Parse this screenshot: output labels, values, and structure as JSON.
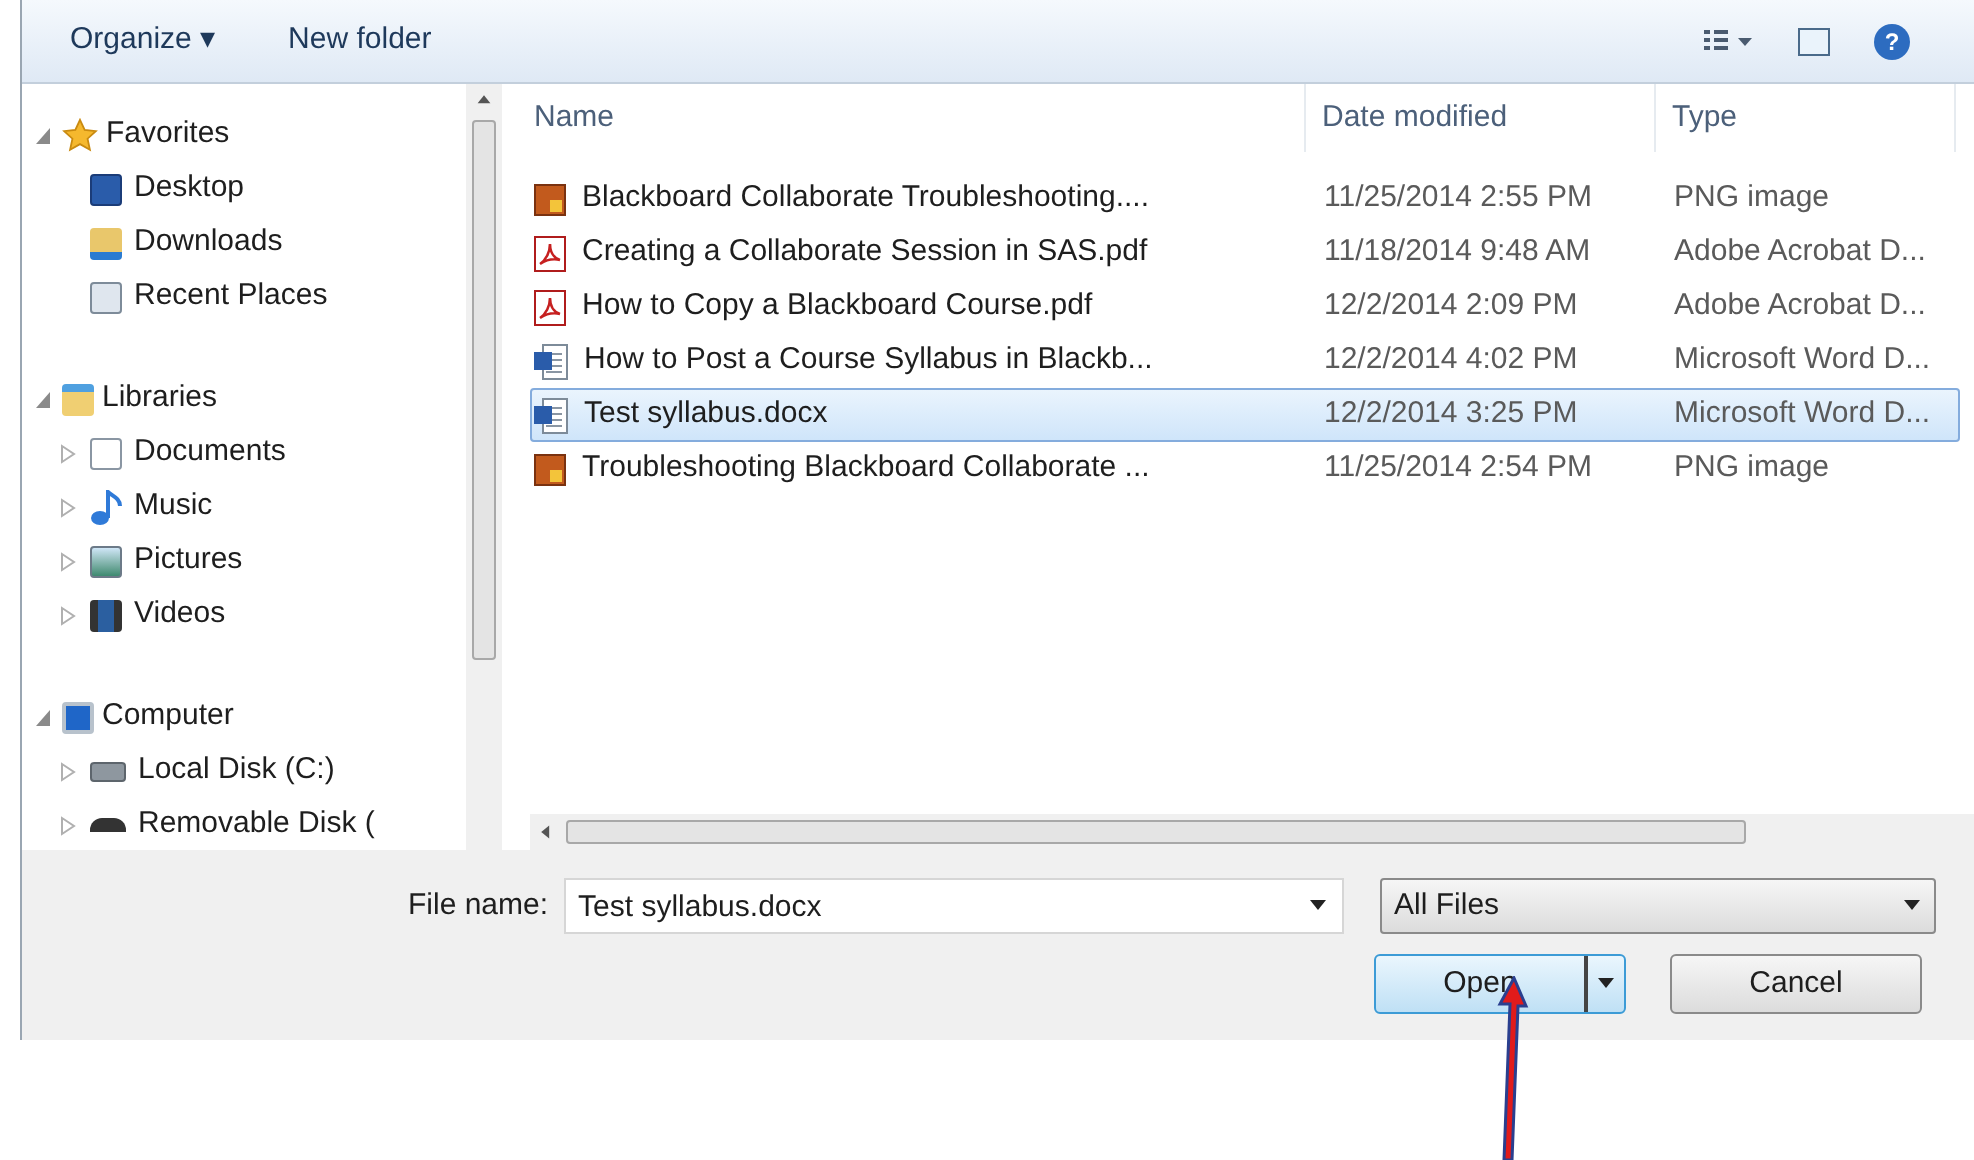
{
  "toolbar": {
    "organize": "Organize ▾",
    "new_folder": "New folder",
    "help": "?"
  },
  "sidebar": [
    {
      "label": "Favorites",
      "kind": "star",
      "expanded": true,
      "children": [
        {
          "label": "Desktop",
          "kind": "desktop",
          "has_children": false
        },
        {
          "label": "Downloads",
          "kind": "downloads",
          "has_children": false
        },
        {
          "label": "Recent Places",
          "kind": "recent",
          "has_children": false
        }
      ]
    },
    {
      "label": "Libraries",
      "kind": "library",
      "expanded": true,
      "children": [
        {
          "label": "Documents",
          "kind": "documents",
          "has_children": true
        },
        {
          "label": "Music",
          "kind": "music",
          "has_children": true
        },
        {
          "label": "Pictures",
          "kind": "pictures",
          "has_children": true
        },
        {
          "label": "Videos",
          "kind": "videos",
          "has_children": true
        }
      ]
    },
    {
      "label": "Computer",
      "kind": "computer",
      "expanded": true,
      "children": [
        {
          "label": "Local Disk (C:)",
          "kind": "disk",
          "has_children": true
        },
        {
          "label": "Removable Disk (",
          "kind": "removable",
          "has_children": true
        }
      ]
    }
  ],
  "table": {
    "columns": [
      "Name",
      "Date modified",
      "Type"
    ],
    "rows": [
      {
        "kind": "png",
        "name": "Blackboard Collaborate Troubleshooting....",
        "date": "11/25/2014 2:55 PM",
        "type": "PNG image",
        "selected": false
      },
      {
        "kind": "pdf",
        "name": "Creating a Collaborate Session in SAS.pdf",
        "date": "11/18/2014 9:48 AM",
        "type": "Adobe Acrobat D...",
        "selected": false
      },
      {
        "kind": "pdf",
        "name": "How to Copy a Blackboard Course.pdf",
        "date": "12/2/2014 2:09 PM",
        "type": "Adobe Acrobat D...",
        "selected": false
      },
      {
        "kind": "word",
        "name": "How to Post a Course Syllabus in Blackb...",
        "date": "12/2/2014 4:02 PM",
        "type": "Microsoft Word D...",
        "selected": false
      },
      {
        "kind": "word",
        "name": "Test syllabus.docx",
        "date": "12/2/2014 3:25 PM",
        "type": "Microsoft Word D...",
        "selected": true
      },
      {
        "kind": "png",
        "name": "Troubleshooting Blackboard Collaborate ...",
        "date": "11/25/2014 2:54 PM",
        "type": "PNG image",
        "selected": false
      }
    ]
  },
  "file_name": {
    "label": "File name:",
    "value": "Test syllabus.docx"
  },
  "file_type": {
    "value": "All Files"
  },
  "buttons": {
    "open": "Open",
    "cancel": "Cancel"
  }
}
